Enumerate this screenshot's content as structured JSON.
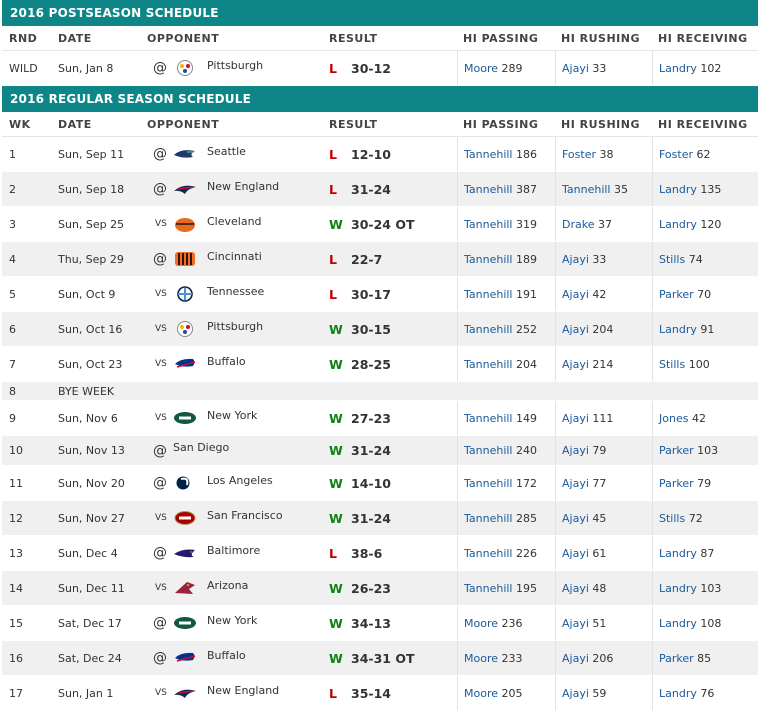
{
  "postseason": {
    "title": "2016 POSTSEASON SCHEDULE",
    "headers": [
      "RND",
      "DATE",
      "OPPONENT",
      "RESULT",
      "HI PASSING",
      "HI RUSHING",
      "HI RECEIVING"
    ],
    "rows": [
      {
        "num": "WILD",
        "date": "Sun, Jan 8",
        "loc": "@",
        "logo": "steelers-icon",
        "opp": "Pittsburgh",
        "wl": "L",
        "score": "30-12",
        "pass_p": "Moore",
        "pass_v": "289",
        "rush_p": "Ajayi",
        "rush_v": "33",
        "rec_p": "Landry",
        "rec_v": "102"
      }
    ]
  },
  "regular": {
    "title": "2016 REGULAR SEASON SCHEDULE",
    "headers": [
      "WK",
      "DATE",
      "OPPONENT",
      "RESULT",
      "HI PASSING",
      "HI RUSHING",
      "HI RECEIVING"
    ],
    "rows": [
      {
        "num": "1",
        "date": "Sun, Sep 11",
        "loc": "@",
        "logo": "seahawks-icon",
        "opp": "Seattle",
        "wl": "L",
        "score": "12-10",
        "pass_p": "Tannehill",
        "pass_v": "186",
        "rush_p": "Foster",
        "rush_v": "38",
        "rec_p": "Foster",
        "rec_v": "62"
      },
      {
        "num": "2",
        "date": "Sun, Sep 18",
        "loc": "@",
        "logo": "patriots-icon",
        "opp": "New England",
        "wl": "L",
        "score": "31-24",
        "pass_p": "Tannehill",
        "pass_v": "387",
        "rush_p": "Tannehill",
        "rush_v": "35",
        "rec_p": "Landry",
        "rec_v": "135"
      },
      {
        "num": "3",
        "date": "Sun, Sep 25",
        "loc": "VS",
        "logo": "browns-icon",
        "opp": "Cleveland",
        "wl": "W",
        "score": "30-24 OT",
        "pass_p": "Tannehill",
        "pass_v": "319",
        "rush_p": "Drake",
        "rush_v": "37",
        "rec_p": "Landry",
        "rec_v": "120"
      },
      {
        "num": "4",
        "date": "Thu, Sep 29",
        "loc": "@",
        "logo": "bengals-icon",
        "opp": "Cincinnati",
        "wl": "L",
        "score": "22-7",
        "pass_p": "Tannehill",
        "pass_v": "189",
        "rush_p": "Ajayi",
        "rush_v": "33",
        "rec_p": "Stills",
        "rec_v": "74"
      },
      {
        "num": "5",
        "date": "Sun, Oct 9",
        "loc": "VS",
        "logo": "titans-icon",
        "opp": "Tennessee",
        "wl": "L",
        "score": "30-17",
        "pass_p": "Tannehill",
        "pass_v": "191",
        "rush_p": "Ajayi",
        "rush_v": "42",
        "rec_p": "Parker",
        "rec_v": "70"
      },
      {
        "num": "6",
        "date": "Sun, Oct 16",
        "loc": "VS",
        "logo": "steelers-icon",
        "opp": "Pittsburgh",
        "wl": "W",
        "score": "30-15",
        "pass_p": "Tannehill",
        "pass_v": "252",
        "rush_p": "Ajayi",
        "rush_v": "204",
        "rec_p": "Landry",
        "rec_v": "91"
      },
      {
        "num": "7",
        "date": "Sun, Oct 23",
        "loc": "VS",
        "logo": "bills-icon",
        "opp": "Buffalo",
        "wl": "W",
        "score": "28-25",
        "pass_p": "Tannehill",
        "pass_v": "204",
        "rush_p": "Ajayi",
        "rush_v": "214",
        "rec_p": "Stills",
        "rec_v": "100"
      },
      {
        "num": "8",
        "date": "BYE WEEK",
        "bye": true
      },
      {
        "num": "9",
        "date": "Sun, Nov 6",
        "loc": "VS",
        "logo": "jets-icon",
        "opp": "New York",
        "wl": "W",
        "score": "27-23",
        "pass_p": "Tannehill",
        "pass_v": "149",
        "rush_p": "Ajayi",
        "rush_v": "111",
        "rec_p": "Jones",
        "rec_v": "42"
      },
      {
        "num": "10",
        "date": "Sun, Nov 13",
        "loc": "@",
        "logo": "",
        "opp": "San Diego",
        "wl": "W",
        "score": "31-24",
        "pass_p": "Tannehill",
        "pass_v": "240",
        "rush_p": "Ajayi",
        "rush_v": "79",
        "rec_p": "Parker",
        "rec_v": "103",
        "short": true
      },
      {
        "num": "11",
        "date": "Sun, Nov 20",
        "loc": "@",
        "logo": "rams-icon",
        "opp": "Los Angeles",
        "wl": "W",
        "score": "14-10",
        "pass_p": "Tannehill",
        "pass_v": "172",
        "rush_p": "Ajayi",
        "rush_v": "77",
        "rec_p": "Parker",
        "rec_v": "79"
      },
      {
        "num": "12",
        "date": "Sun, Nov 27",
        "loc": "VS",
        "logo": "49ers-icon",
        "opp": "San Francisco",
        "wl": "W",
        "score": "31-24",
        "pass_p": "Tannehill",
        "pass_v": "285",
        "rush_p": "Ajayi",
        "rush_v": "45",
        "rec_p": "Stills",
        "rec_v": "72"
      },
      {
        "num": "13",
        "date": "Sun, Dec 4",
        "loc": "@",
        "logo": "ravens-icon",
        "opp": "Baltimore",
        "wl": "L",
        "score": "38-6",
        "pass_p": "Tannehill",
        "pass_v": "226",
        "rush_p": "Ajayi",
        "rush_v": "61",
        "rec_p": "Landry",
        "rec_v": "87"
      },
      {
        "num": "14",
        "date": "Sun, Dec 11",
        "loc": "VS",
        "logo": "cardinals-icon",
        "opp": "Arizona",
        "wl": "W",
        "score": "26-23",
        "pass_p": "Tannehill",
        "pass_v": "195",
        "rush_p": "Ajayi",
        "rush_v": "48",
        "rec_p": "Landry",
        "rec_v": "103"
      },
      {
        "num": "15",
        "date": "Sat, Dec 17",
        "loc": "@",
        "logo": "jets-icon",
        "opp": "New York",
        "wl": "W",
        "score": "34-13",
        "pass_p": "Moore",
        "pass_v": "236",
        "rush_p": "Ajayi",
        "rush_v": "51",
        "rec_p": "Landry",
        "rec_v": "108"
      },
      {
        "num": "16",
        "date": "Sat, Dec 24",
        "loc": "@",
        "logo": "bills-icon",
        "opp": "Buffalo",
        "wl": "W",
        "score": "34-31 OT",
        "pass_p": "Moore",
        "pass_v": "233",
        "rush_p": "Ajayi",
        "rush_v": "206",
        "rec_p": "Parker",
        "rec_v": "85"
      },
      {
        "num": "17",
        "date": "Sun, Jan 1",
        "loc": "VS",
        "logo": "patriots-icon",
        "opp": "New England",
        "wl": "L",
        "score": "35-14",
        "pass_p": "Moore",
        "pass_v": "205",
        "rush_p": "Ajayi",
        "rush_v": "59",
        "rec_p": "Landry",
        "rec_v": "76"
      }
    ]
  },
  "colors": {
    "header_bg": "#0e8688",
    "win": "#108010",
    "loss": "#c00000",
    "player_link": "#1a5a9a",
    "row_alt": "#f0f0f0"
  }
}
